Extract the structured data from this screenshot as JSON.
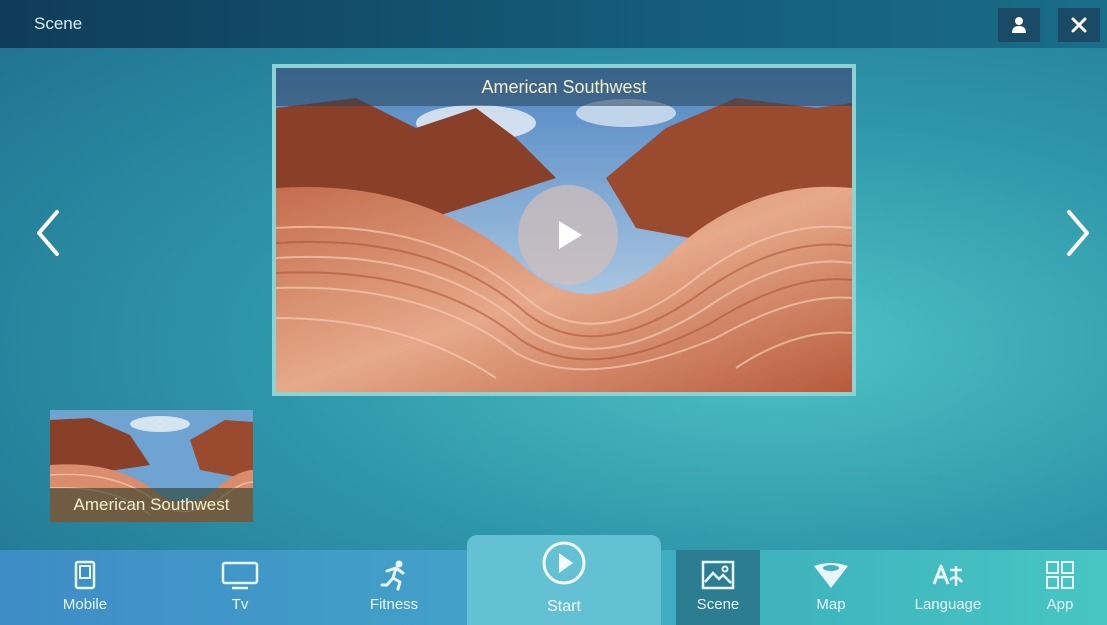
{
  "window": {
    "title": "Scene"
  },
  "topbar": {
    "user_icon": "user-icon",
    "close_icon": "close-icon"
  },
  "featured": {
    "title": "American Southwest",
    "play_icon": "play-icon"
  },
  "navigation": {
    "prev_icon": "chevron-left-icon",
    "next_icon": "chevron-right-icon"
  },
  "scenes": [
    {
      "label": "American Southwest"
    }
  ],
  "bottom_nav": {
    "items": [
      {
        "label": "Mobile",
        "icon": "tablet-icon"
      },
      {
        "label": "Tv",
        "icon": "tv-icon"
      },
      {
        "label": "Fitness",
        "icon": "runner-icon"
      },
      {
        "label": "Start",
        "icon": "play-circle-icon"
      },
      {
        "label": "Scene",
        "icon": "image-icon",
        "active": true
      },
      {
        "label": "Map",
        "icon": "map-pin-icon"
      },
      {
        "label": "Language",
        "icon": "language-icon"
      },
      {
        "label": "App",
        "icon": "grid-icon"
      }
    ]
  },
  "colors": {
    "accent": "#63c1d3",
    "active_tab": "#2c7d91",
    "caption_text": "#f3f0c8"
  }
}
